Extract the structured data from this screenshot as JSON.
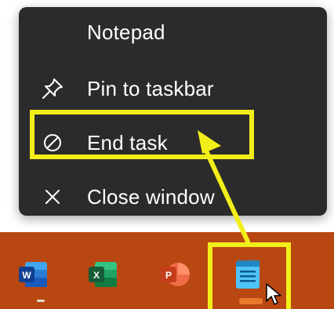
{
  "context_menu": {
    "app_title": "Notepad",
    "items": [
      {
        "label": "Pin to taskbar",
        "icon": "pin-icon"
      },
      {
        "label": "End task",
        "icon": "prohibited-icon"
      },
      {
        "label": "Close window",
        "icon": "close-icon"
      }
    ]
  },
  "taskbar": {
    "apps": [
      {
        "name": "word-icon",
        "letter": "W"
      },
      {
        "name": "excel-icon",
        "letter": "X"
      },
      {
        "name": "powerpoint-icon",
        "letter": "P"
      },
      {
        "name": "notepad-icon"
      }
    ]
  },
  "colors": {
    "menu_bg": "#2b2b2b",
    "taskbar_bg": "#b84712",
    "highlight": "#f2ee1a",
    "menu_text": "#ffffff"
  }
}
